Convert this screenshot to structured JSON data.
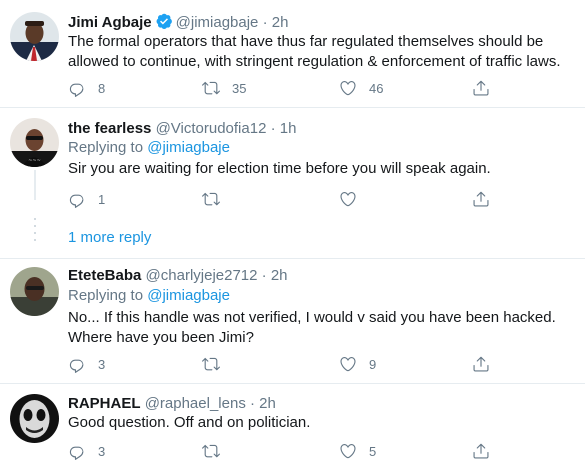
{
  "tweets": [
    {
      "name": "Jimi Agbaje",
      "handle": "@jimiagbaje",
      "separator": "·",
      "time": "2h",
      "verified": true,
      "text": "The formal operators that have thus far regulated themselves should be allowed to continue, with stringent regulation & enforcement of traffic laws.",
      "replies": "8",
      "retweets": "35",
      "likes": "46"
    },
    {
      "name": "the fearless",
      "handle": "@Victorudofia12",
      "separator": "·",
      "time": "1h",
      "replying_prefix": "Replying to",
      "replying_to": "@jimiagbaje",
      "text": "Sir you are waiting for election time before you will speak again.",
      "replies": "1",
      "retweets": "",
      "likes": ""
    },
    {
      "name": "EteteBaba",
      "handle": "@charlyjeje2712",
      "separator": "·",
      "time": "2h",
      "replying_prefix": "Replying to",
      "replying_to": "@jimiagbaje",
      "text": "No... If this handle was not verified, I would v said you have been hacked. Where have you been Jimi?",
      "replies": "3",
      "retweets": "",
      "likes": "9"
    },
    {
      "name": "RAPHAEL",
      "handle": "@raphael_lens",
      "separator": "·",
      "time": "2h",
      "text": "Good question. Off and on politician.",
      "replies": "3",
      "retweets": "",
      "likes": "5"
    }
  ],
  "more_reply_label": "1 more reply",
  "icons": [
    "verified-badge-icon",
    "reply-icon",
    "retweet-icon",
    "like-icon",
    "share-icon"
  ],
  "colors": {
    "accent": "#1da1f2",
    "link": "#1b95e0",
    "muted": "#657786",
    "divider": "#e6ecf0"
  }
}
